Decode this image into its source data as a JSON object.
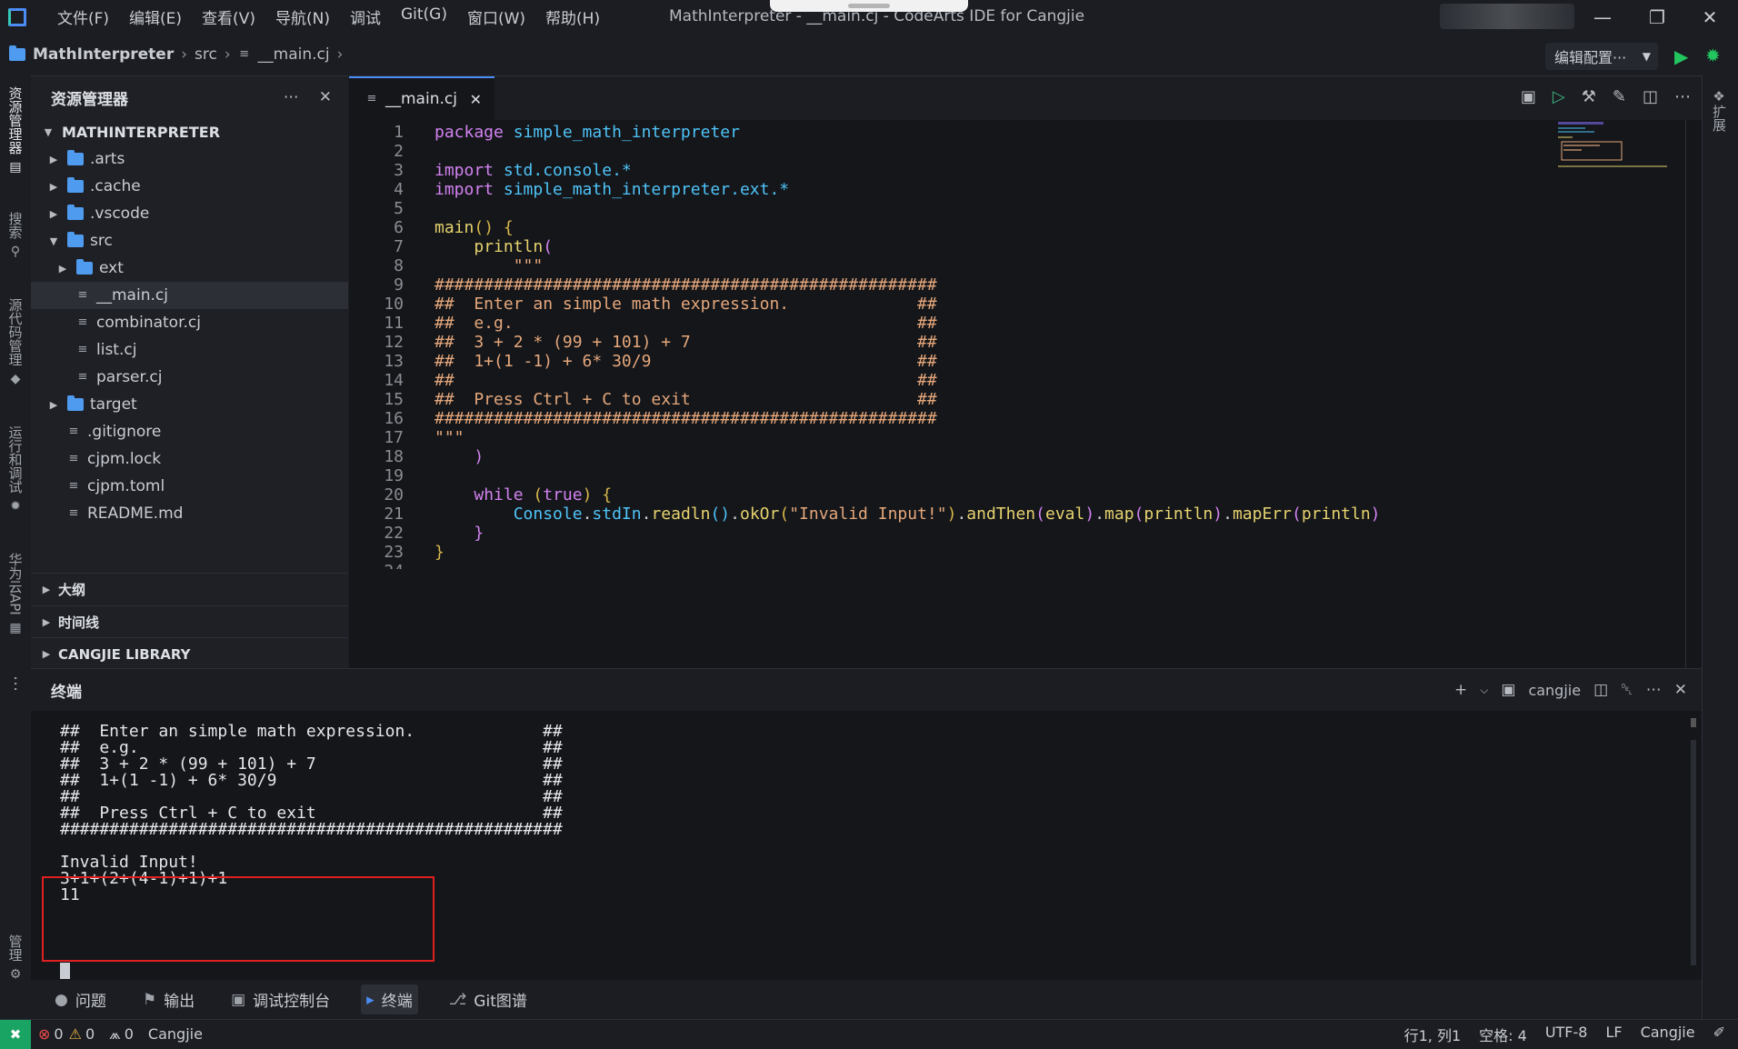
{
  "titlebar": {
    "menus": [
      "文件(F)",
      "编辑(E)",
      "查看(V)",
      "导航(N)",
      "调试",
      "Git(G)",
      "窗口(W)",
      "帮助(H)"
    ],
    "window_title": "MathInterpreter - __main.cj - CodeArts IDE for Cangjie"
  },
  "breadcrumb": {
    "project": "MathInterpreter",
    "folder": "src",
    "file": "__main.cj",
    "run_config": "编辑配置···"
  },
  "activity": [
    "资源管理器",
    "搜索",
    "源代码管理",
    "运行和调试",
    "华为云API",
    "管理"
  ],
  "right_rail": "扩展",
  "explorer": {
    "title": "资源管理器",
    "root": "MATHINTERPRETER",
    "items": [
      {
        "label": ".arts",
        "kind": "folder",
        "depth": 0,
        "state": "collapsed"
      },
      {
        "label": ".cache",
        "kind": "folder",
        "depth": 0,
        "state": "collapsed"
      },
      {
        "label": ".vscode",
        "kind": "folder",
        "depth": 0,
        "state": "collapsed"
      },
      {
        "label": "src",
        "kind": "folder",
        "depth": 0,
        "state": "expanded"
      },
      {
        "label": "ext",
        "kind": "folder",
        "depth": 1,
        "state": "collapsed"
      },
      {
        "label": "__main.cj",
        "kind": "file",
        "depth": 1,
        "selected": true
      },
      {
        "label": "combinator.cj",
        "kind": "file",
        "depth": 1
      },
      {
        "label": "list.cj",
        "kind": "file",
        "depth": 1
      },
      {
        "label": "parser.cj",
        "kind": "file",
        "depth": 1
      },
      {
        "label": "target",
        "kind": "folder",
        "depth": 0,
        "state": "collapsed"
      },
      {
        "label": ".gitignore",
        "kind": "file",
        "depth": 0
      },
      {
        "label": "cjpm.lock",
        "kind": "file",
        "depth": 0
      },
      {
        "label": "cjpm.toml",
        "kind": "file",
        "depth": 0
      },
      {
        "label": "README.md",
        "kind": "file",
        "depth": 0
      }
    ],
    "sections": [
      "大纲",
      "时间线",
      "CANGJIE LIBRARY"
    ]
  },
  "editor": {
    "tab": "__main.cj",
    "lines": [
      [
        [
          "kw",
          "package "
        ],
        [
          "ty",
          "simple_math_interpreter"
        ]
      ],
      [],
      [
        [
          "kw",
          "import "
        ],
        [
          "ty",
          "std.console.*"
        ]
      ],
      [
        [
          "kw",
          "import "
        ],
        [
          "ty",
          "simple_math_interpreter.ext.*"
        ]
      ],
      [],
      [
        [
          "fn",
          "main"
        ],
        [
          "br",
          "() {"
        ]
      ],
      [
        [
          "tx",
          "    "
        ],
        [
          "fn",
          "println"
        ],
        [
          "kw",
          "("
        ]
      ],
      [
        [
          "tx",
          "        "
        ],
        [
          "str",
          "\"\"\""
        ]
      ],
      [
        [
          "cm",
          "###################################################"
        ]
      ],
      [
        [
          "cm",
          "##  Enter an simple math expression.             ##"
        ]
      ],
      [
        [
          "cm",
          "##  e.g.                                         ##"
        ]
      ],
      [
        [
          "cm",
          "##  3 + 2 * (99 + 101) + 7                       ##"
        ]
      ],
      [
        [
          "cm",
          "##  1+(1 -1) + 6* 30/9                           ##"
        ]
      ],
      [
        [
          "cm",
          "##                                               ##"
        ]
      ],
      [
        [
          "cm",
          "##  Press Ctrl + C to exit                       ##"
        ]
      ],
      [
        [
          "cm",
          "###################################################"
        ]
      ],
      [
        [
          "str",
          "\"\"\""
        ]
      ],
      [
        [
          "tx",
          "    "
        ],
        [
          "kw",
          ")"
        ]
      ],
      [],
      [
        [
          "tx",
          "    "
        ],
        [
          "kw",
          "while "
        ],
        [
          "br",
          "("
        ],
        [
          "kw",
          "true"
        ],
        [
          "br",
          ") {"
        ]
      ],
      [
        [
          "tx",
          "        "
        ],
        [
          "ty",
          "Console"
        ],
        [
          "tx",
          "."
        ],
        [
          "ty",
          "stdIn"
        ],
        [
          "tx",
          "."
        ],
        [
          "fn",
          "readln"
        ],
        [
          "ty",
          "()"
        ],
        [
          "tx",
          "."
        ],
        [
          "fn",
          "okOr"
        ],
        [
          "br",
          "("
        ],
        [
          "str",
          "\"Invalid Input!\""
        ],
        [
          "br",
          ")"
        ],
        [
          "tx",
          "."
        ],
        [
          "fn",
          "andThen"
        ],
        [
          "kw",
          "("
        ],
        [
          "fn",
          "eval"
        ],
        [
          "kw",
          ")"
        ],
        [
          "tx",
          "."
        ],
        [
          "fn",
          "map"
        ],
        [
          "kw",
          "("
        ],
        [
          "fn",
          "println"
        ],
        [
          "kw",
          ")"
        ],
        [
          "tx",
          "."
        ],
        [
          "fn",
          "mapErr"
        ],
        [
          "kw",
          "("
        ],
        [
          "fn",
          "println"
        ],
        [
          "kw",
          ")"
        ]
      ],
      [
        [
          "tx",
          "    "
        ],
        [
          "kw",
          "}"
        ]
      ],
      [
        [
          "br",
          "}"
        ]
      ]
    ],
    "partial_line_number": "24"
  },
  "terminal": {
    "title": "终端",
    "profile": "cangjie",
    "lines": [
      "##  Enter an simple math expression.             ##",
      "##  e.g.                                         ##",
      "##  3 + 2 * (99 + 101) + 7                       ##",
      "##  1+(1 -1) + 6* 30/9                           ##",
      "##                                               ##",
      "##  Press Ctrl + C to exit                       ##",
      "###################################################",
      "",
      "Invalid Input!",
      "3+1+(2+(4-1)+1)+1",
      "11"
    ]
  },
  "panel_tabs": [
    {
      "label": "问题",
      "icon": "problems-icon"
    },
    {
      "label": "输出",
      "icon": "flag-icon"
    },
    {
      "label": "调试控制台",
      "icon": "debug-console-icon"
    },
    {
      "label": "终端",
      "icon": "terminal-icon",
      "active": true
    },
    {
      "label": "Git图谱",
      "icon": "git-graph-icon"
    }
  ],
  "status": {
    "errors": "0",
    "warnings": "0",
    "ports": "0",
    "lang_left": "Cangjie",
    "position": "行1, 列1",
    "indent": "空格: 4",
    "encoding": "UTF-8",
    "eol": "LF",
    "language": "Cangjie"
  },
  "colors": {
    "accent": "#4c8cf5",
    "remote": "#19a463",
    "highlight_box": "#e02020"
  }
}
